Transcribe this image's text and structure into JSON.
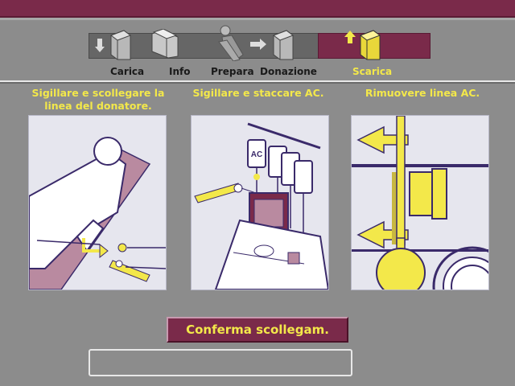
{
  "steps": [
    {
      "label": "Carica",
      "icon": "load-kit-icon",
      "state": "done"
    },
    {
      "label": "Info",
      "icon": "info-folder-icon",
      "state": "done"
    },
    {
      "label": "Prepara",
      "icon": "prepare-donor-icon",
      "state": "done"
    },
    {
      "label": "Donazione",
      "icon": "donation-icon",
      "state": "done"
    },
    {
      "label": "Scarica",
      "icon": "unload-kit-icon",
      "state": "active"
    }
  ],
  "instructions": [
    {
      "caption_line1": "Sigillare e scollegare la",
      "caption_line2": "linea del donatore.",
      "illustration": "seal-donor-line-illustration"
    },
    {
      "caption_line1": "Sigillare e staccare AC.",
      "caption_line2": "",
      "illustration": "seal-ac-illustration",
      "bag_label": "AC"
    },
    {
      "caption_line1": "Rimuovere linea AC.",
      "caption_line2": "",
      "illustration": "remove-ac-line-illustration"
    }
  ],
  "confirm_button": {
    "label": "Conferma scollegam."
  },
  "message_box": {
    "text": ""
  },
  "colors": {
    "accent": "#7a2a4a",
    "highlight": "#f3e84a",
    "background": "#8c8c8c"
  }
}
